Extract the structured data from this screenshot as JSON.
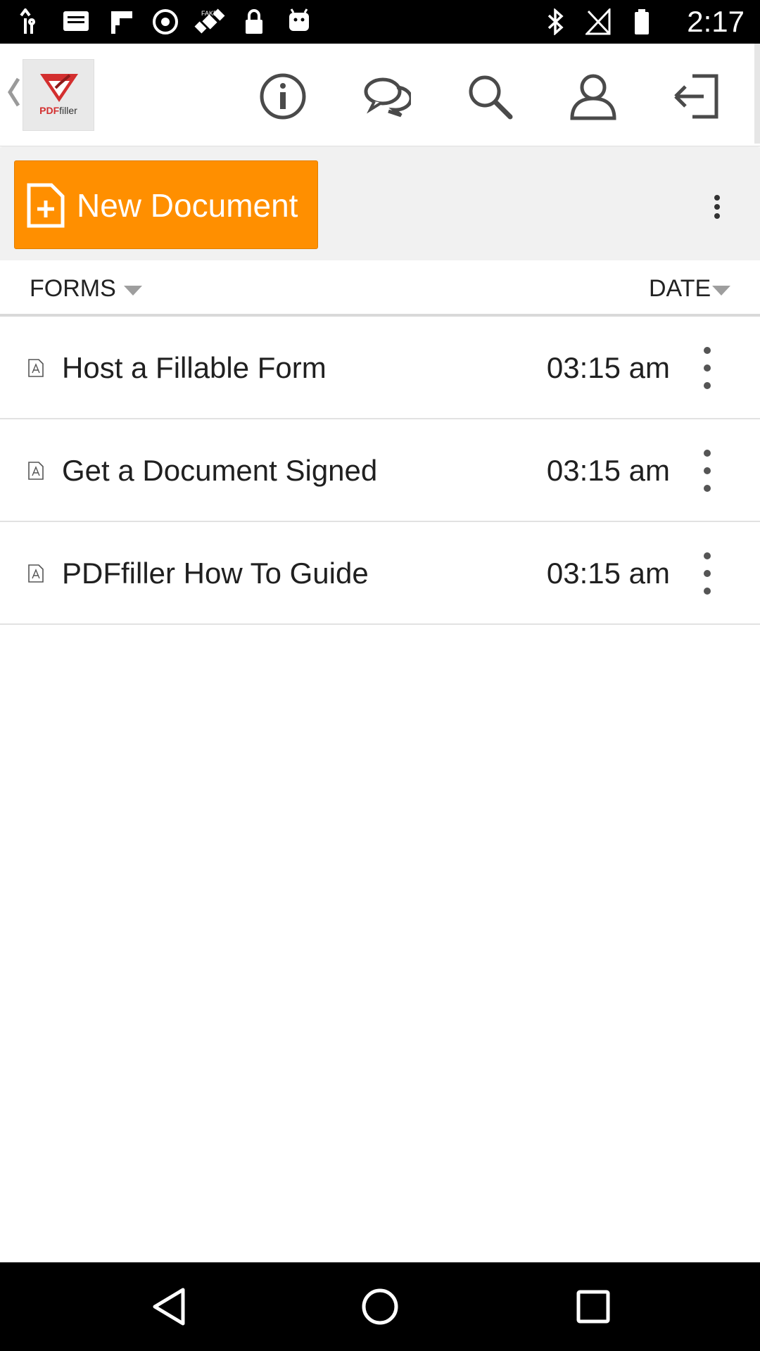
{
  "status_bar": {
    "time": "2:17",
    "icons": [
      "signal-icon",
      "message-icon",
      "flipboard-icon",
      "settings-icon",
      "satellite-icon",
      "lock-icon",
      "android-icon",
      "bluetooth-icon",
      "cellular-off-icon",
      "battery-icon"
    ]
  },
  "app_bar": {
    "logo_text_part1": "PDF",
    "logo_text_part2": "filler",
    "actions": [
      "info-icon",
      "chat-icon",
      "search-icon",
      "account-icon",
      "logout-icon"
    ]
  },
  "toolbar": {
    "new_document_label": "New Document"
  },
  "sort": {
    "forms_label": "FORMS",
    "date_label": "DATE"
  },
  "documents": [
    {
      "title": "Host a Fillable Form",
      "time": "03:15 am"
    },
    {
      "title": "Get a Document Signed",
      "time": "03:15 am"
    },
    {
      "title": "PDFfiller How To Guide",
      "time": "03:15 am"
    }
  ],
  "colors": {
    "accent": "#ff8f00",
    "brand_red": "#d32f2f",
    "icon_gray": "#555555",
    "toolbar_bg": "#f1f1f1"
  }
}
